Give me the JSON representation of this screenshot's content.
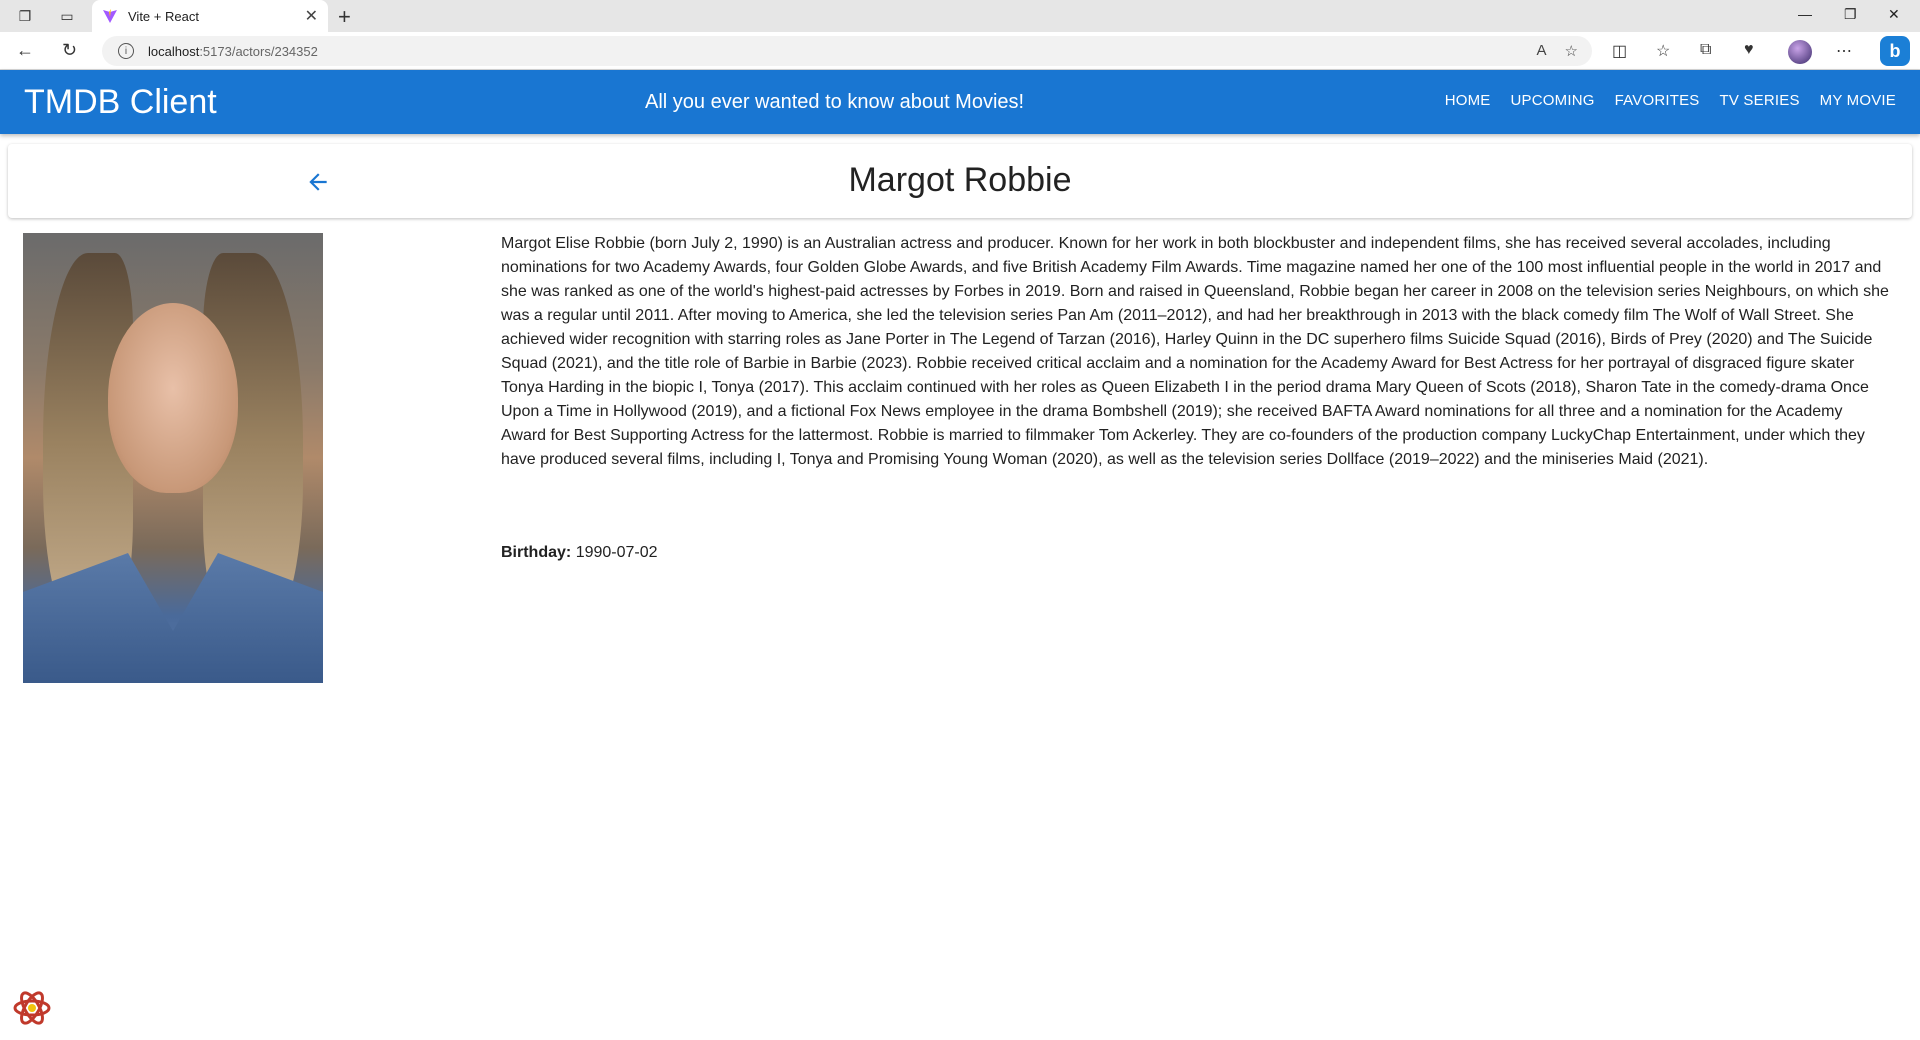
{
  "browser": {
    "tab_title": "Vite + React",
    "url_host": "localhost",
    "url_path": ":5173/actors/234352"
  },
  "header": {
    "brand": "TMDB Client",
    "tagline": "All you ever wanted to know about Movies!",
    "nav": [
      "HOME",
      "UPCOMING",
      "FAVORITES",
      "TV SERIES",
      "MY MOVIE"
    ]
  },
  "actor": {
    "name": "Margot Robbie",
    "biography": "Margot Elise Robbie (born July 2, 1990) is an Australian actress and producer. Known for her work in both blockbuster and independent films, she has received several accolades, including nominations for two Academy Awards, four Golden Globe Awards, and five British Academy Film Awards. Time magazine named her one of the 100 most influential people in the world in 2017 and she was ranked as one of the world's highest-paid actresses by Forbes in 2019. Born and raised in Queensland, Robbie began her career in 2008 on the television series Neighbours, on which she was a regular until 2011. After moving to America, she led the television series Pan Am (2011–2012), and had her breakthrough in 2013 with the black comedy film The Wolf of Wall Street. She achieved wider recognition with starring roles as Jane Porter in The Legend of Tarzan (2016), Harley Quinn in the DC superhero films Suicide Squad (2016), Birds of Prey (2020) and The Suicide Squad (2021), and the title role of Barbie in Barbie (2023). Robbie received critical acclaim and a nomination for the Academy Award for Best Actress for her portrayal of disgraced figure skater Tonya Harding in the biopic I, Tonya (2017). This acclaim continued with her roles as Queen Elizabeth I in the period drama Mary Queen of Scots (2018), Sharon Tate in the comedy-drama Once Upon a Time in Hollywood (2019), and a fictional Fox News employee in the drama Bombshell (2019); she received BAFTA Award nominations for all three and a nomination for the Academy Award for Best Supporting Actress for the lattermost. Robbie is married to filmmaker Tom Ackerley. They are co-founders of the production company LuckyChap Entertainment, under which they have produced several films, including I, Tonya and Promising Young Woman (2020), as well as the television series Dollface (2019–2022) and the miniseries Maid (2021).",
    "birthday_label": "Birthday:",
    "birthday": "1990-07-02"
  },
  "colors": {
    "primary": "#1976d2"
  }
}
